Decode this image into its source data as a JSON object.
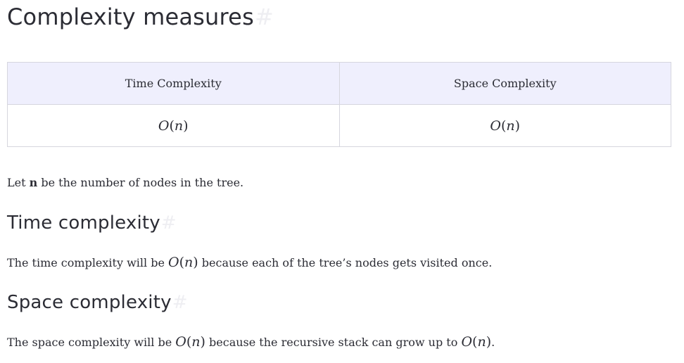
{
  "heading": {
    "title": "Complexity measures",
    "anchor": "#"
  },
  "table": {
    "headers": [
      "Time Complexity",
      "Space Complexity"
    ],
    "rows": [
      {
        "time": {
          "fn": "O",
          "var": "n"
        },
        "space": {
          "fn": "O",
          "var": "n"
        }
      }
    ]
  },
  "intro": {
    "pre": "Let ",
    "bold": "n",
    "post": " be the number of nodes in the tree."
  },
  "time_section": {
    "title": "Time complexity",
    "anchor": "#",
    "text_pre": "The time complexity will be ",
    "math": {
      "fn": "O",
      "var": "n"
    },
    "text_post": " because each of the tree’s nodes gets visited once."
  },
  "space_section": {
    "title": "Space complexity",
    "anchor": "#",
    "text_pre": "The space complexity will be ",
    "math1": {
      "fn": "O",
      "var": "n"
    },
    "text_mid": " because the recursive stack can grow up to ",
    "math2": {
      "fn": "O",
      "var": "n"
    },
    "text_post": "."
  }
}
